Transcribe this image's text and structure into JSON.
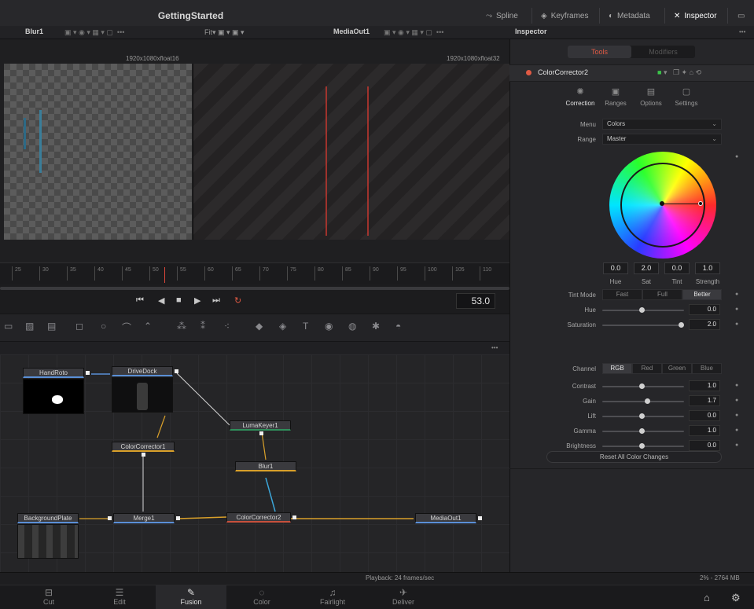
{
  "app": {
    "title": "GettingStarted"
  },
  "header_tabs": [
    {
      "label": "Spline",
      "icon": "spline-icon"
    },
    {
      "label": "Keyframes",
      "icon": "keyframes-icon"
    },
    {
      "label": "Metadata",
      "icon": "metadata-icon"
    },
    {
      "label": "Inspector",
      "icon": "inspector-icon",
      "active": true
    }
  ],
  "viewers": {
    "left": {
      "name": "Blur1",
      "fit": "Fit",
      "resolution": "1920x1080xfloat16"
    },
    "right": {
      "name": "MediaOut1",
      "resolution": "1920x1080xfloat32"
    },
    "more": "•••"
  },
  "timeline": {
    "ticks": [
      "25",
      "30",
      "35",
      "40",
      "45",
      "50",
      "55",
      "60",
      "65",
      "70",
      "75",
      "80",
      "85",
      "90",
      "95",
      "100",
      "105",
      "110"
    ],
    "current_frame": "53.0"
  },
  "nodes": {
    "more": "•••",
    "items": [
      "HandRoto",
      "DriveDock",
      "LumaKeyer1",
      "ColorCorrector1",
      "Blur1",
      "BackgroundPlate",
      "Merge1",
      "ColorCorrector2",
      "MediaOut1"
    ]
  },
  "status": {
    "playback": "Playback: 24 frames/sec",
    "memory": "2% - 2764 MB"
  },
  "pages": [
    {
      "label": "Cut",
      "icon": "cut-icon"
    },
    {
      "label": "Edit",
      "icon": "edit-icon"
    },
    {
      "label": "Fusion",
      "icon": "fusion-icon",
      "active": true
    },
    {
      "label": "Color",
      "icon": "color-icon"
    },
    {
      "label": "Fairlight",
      "icon": "fairlight-icon"
    },
    {
      "label": "Deliver",
      "icon": "deliver-icon"
    }
  ],
  "inspector": {
    "title": "Inspector",
    "more": "•••",
    "tabs": {
      "tools": "Tools",
      "modifiers": "Modifiers"
    },
    "node_name": "ColorCorrector2",
    "subtabs": [
      "Correction",
      "Ranges",
      "Options",
      "Settings"
    ],
    "menu": {
      "label": "Menu",
      "value": "Colors"
    },
    "range": {
      "label": "Range",
      "value": "Master"
    },
    "wheel": {
      "hue": "0.0",
      "sat": "2.0",
      "tint": "0.0",
      "strength": "1.0",
      "labels": [
        "Hue",
        "Sat",
        "Tint",
        "Strength"
      ]
    },
    "tint_mode": {
      "label": "Tint Mode",
      "options": [
        "Fast",
        "Full",
        "Better"
      ],
      "selected": "Better"
    },
    "hue": {
      "label": "Hue",
      "value": "0.0",
      "level": 0.5
    },
    "saturation": {
      "label": "Saturation",
      "value": "2.0",
      "level": 1.0
    },
    "channel": {
      "label": "Channel",
      "options": [
        "RGB",
        "Red",
        "Green",
        "Blue"
      ],
      "selected": "RGB"
    },
    "params": [
      {
        "label": "Contrast",
        "value": "1.0",
        "level": 0.5
      },
      {
        "label": "Gain",
        "value": "1.7",
        "level": 0.57
      },
      {
        "label": "Lift",
        "value": "0.0",
        "level": 0.5
      },
      {
        "label": "Gamma",
        "value": "1.0",
        "level": 0.5
      },
      {
        "label": "Brightness",
        "value": "0.0",
        "level": 0.5
      }
    ],
    "reset": "Reset All Color Changes"
  },
  "colors": {
    "accent": "#e05a44",
    "node_blue": "#5a8fd6",
    "node_yellow": "#d9a02a",
    "node_green": "#2f8f5b"
  }
}
